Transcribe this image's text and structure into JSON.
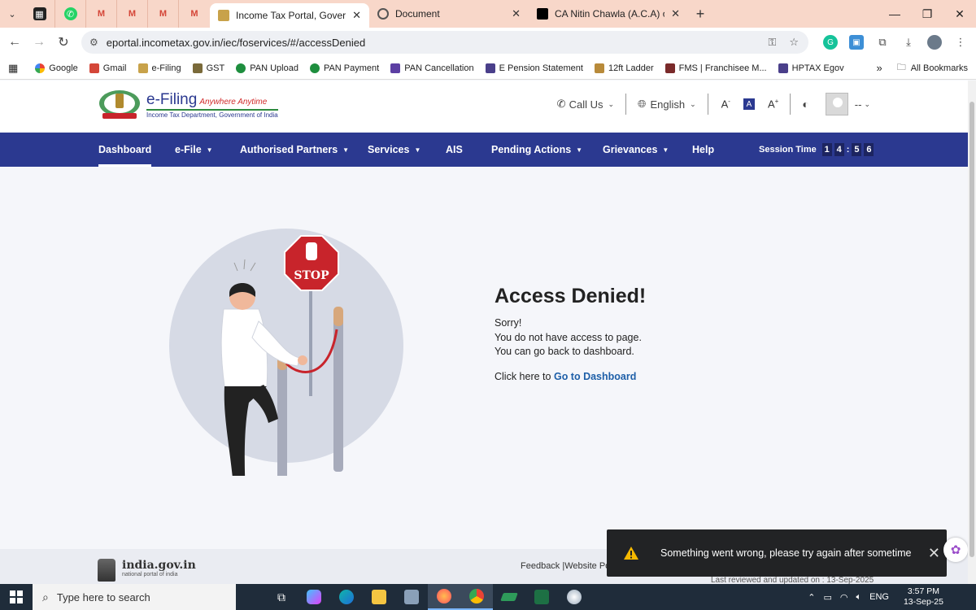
{
  "browser": {
    "tabs": [
      {
        "title": "Income Tax Portal, Government",
        "active": true
      },
      {
        "title": "Document",
        "active": false
      },
      {
        "title": "CA Nitin Chawla (A.C.A) on X: \"E",
        "active": false
      }
    ],
    "url": "eportal.incometax.gov.in/iec/foservices/#/accessDenied",
    "bookmarks": [
      "Google",
      "Gmail",
      "e-Filing",
      "GST",
      "PAN Upload",
      "PAN Payment",
      "PAN Cancellation",
      "E Pension Statement",
      "12ft Ladder",
      "FMS | Franchisee M...",
      "HPTAX Egov"
    ],
    "all_bookmarks": "All Bookmarks",
    "overflow": "»"
  },
  "header": {
    "logo_main": "e-Filing",
    "logo_tagline": "Anywhere Anytime",
    "logo_sub": "Income Tax Department, Government of India",
    "call_us": "Call Us",
    "language": "English",
    "font_small": "A",
    "font_normal": "A",
    "font_large": "A",
    "user": "--"
  },
  "nav": {
    "items": [
      "Dashboard",
      "e-File",
      "Authorised Partners",
      "Services",
      "AIS",
      "Pending Actions",
      "Grievances",
      "Help"
    ],
    "session_label": "Session Time",
    "session_digits": [
      "1",
      "4",
      "5",
      "6"
    ]
  },
  "content": {
    "stop_sign": "STOP",
    "title": "Access Denied!",
    "line1": "Sorry!",
    "line2": "You do not have access to page.",
    "line3": "You can go back to dashboard.",
    "link_prefix": "Click here to",
    "link_text": "Go to Dashboard"
  },
  "footer": {
    "india_main": "india.gov.in",
    "india_sub": "national portal of india",
    "links": "Feedback |Website Polic",
    "last_reviewed": "Last reviewed and updated on : 13-Sep-2025"
  },
  "toast": {
    "message": "Something went wrong, please try again after sometime"
  },
  "taskbar": {
    "search_placeholder": "Type here to search",
    "lang": "ENG",
    "time": "3:57 PM",
    "date": "13-Sep-25"
  },
  "colors": {
    "nav_blue": "#2b3990",
    "link_blue": "#1e5fa8",
    "stop_red": "#c8242b",
    "tab_strip": "#f8d7c9"
  }
}
